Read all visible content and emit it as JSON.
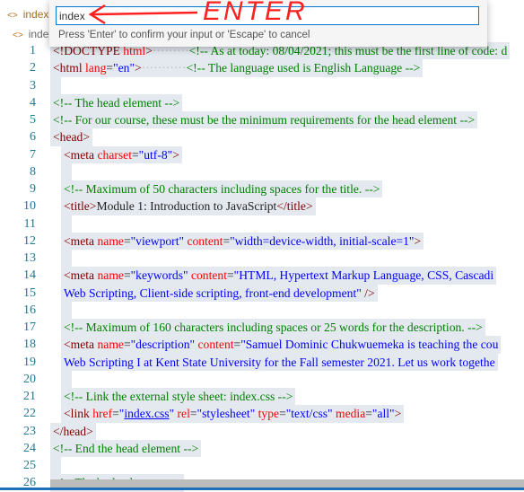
{
  "tab": {
    "label": "index.h",
    "icon": "code-file-icon"
  },
  "breadcrumb": {
    "label": "index.l",
    "icon": "code-file-icon"
  },
  "quick_input": {
    "value": "index",
    "hint": "Press 'Enter' to confirm your input or 'Escape' to cancel"
  },
  "annotation": {
    "text": "ENTER",
    "color": "#ff2020"
  },
  "colors": {
    "tag": "#800000",
    "attribute": "#ff0000",
    "value": "#0000ff",
    "comment": "#008000",
    "line_number": "#237893",
    "selection": "#e4e9f0"
  },
  "lines": [
    {
      "n": "1",
      "indent": 0,
      "t": [
        [
          "tag",
          "<!DOCTYPE "
        ],
        [
          "attr",
          "html"
        ],
        [
          "tag",
          ">"
        ],
        [
          "dots",
          "·········"
        ],
        [
          "cm",
          "<!-- As at today: 08/04/2021; this must be the first line of code: d"
        ]
      ]
    },
    {
      "n": "2",
      "indent": 0,
      "t": [
        [
          "tag",
          "<html "
        ],
        [
          "attr",
          "lang"
        ],
        [
          "pl",
          "="
        ],
        [
          "val",
          "\"en\""
        ],
        [
          "tag",
          ">"
        ],
        [
          "dots",
          "···········"
        ],
        [
          "cm",
          "<!-- The language used is English Language -->"
        ]
      ]
    },
    {
      "n": "3",
      "indent": 0,
      "t": []
    },
    {
      "n": "4",
      "indent": 0,
      "t": [
        [
          "cm",
          "<!-- The head element -->"
        ]
      ]
    },
    {
      "n": "5",
      "indent": 0,
      "t": [
        [
          "cm",
          "<!-- For our course, these must be the minimum requirements for the head element -->"
        ]
      ]
    },
    {
      "n": "6",
      "indent": 0,
      "t": [
        [
          "tag",
          "<head>"
        ]
      ]
    },
    {
      "n": "7",
      "indent": 1,
      "t": [
        [
          "tag",
          "<meta "
        ],
        [
          "attr",
          "charset"
        ],
        [
          "pl",
          "="
        ],
        [
          "val",
          "\"utf-8\""
        ],
        [
          "tag",
          ">"
        ]
      ]
    },
    {
      "n": "8",
      "indent": 1,
      "t": []
    },
    {
      "n": "9",
      "indent": 1,
      "t": [
        [
          "cm",
          "<!-- Maximum of 50 characters including spaces for the title. -->"
        ]
      ]
    },
    {
      "n": "10",
      "indent": 1,
      "t": [
        [
          "tag",
          "<title>"
        ],
        [
          "pl",
          "Module 1: Introduction to JavaScript"
        ],
        [
          "tag",
          "</title>"
        ]
      ]
    },
    {
      "n": "11",
      "indent": 1,
      "t": []
    },
    {
      "n": "12",
      "indent": 1,
      "t": [
        [
          "tag",
          "<meta "
        ],
        [
          "attr",
          "name"
        ],
        [
          "pl",
          "="
        ],
        [
          "val",
          "\"viewport\""
        ],
        [
          "pl",
          " "
        ],
        [
          "attr",
          "content"
        ],
        [
          "pl",
          "="
        ],
        [
          "val",
          "\"width=device-width, initial-scale=1\""
        ],
        [
          "tag",
          ">"
        ]
      ]
    },
    {
      "n": "13",
      "indent": 1,
      "t": []
    },
    {
      "n": "14",
      "indent": 1,
      "t": [
        [
          "tag",
          "<meta "
        ],
        [
          "attr",
          "name"
        ],
        [
          "pl",
          "="
        ],
        [
          "val",
          "\"keywords\""
        ],
        [
          "pl",
          " "
        ],
        [
          "attr",
          "content"
        ],
        [
          "pl",
          "="
        ],
        [
          "val",
          "\"HTML, Hypertext Markup Language, CSS, Cascadi"
        ]
      ]
    },
    {
      "n": "15",
      "indent": 1,
      "t": [
        [
          "val",
          "Web Scripting, Client-side scripting, front-end development\""
        ],
        [
          "tag",
          " />"
        ]
      ]
    },
    {
      "n": "16",
      "indent": 1,
      "t": []
    },
    {
      "n": "17",
      "indent": 1,
      "t": [
        [
          "cm",
          "<!-- Maximum of 160 characters including spaces or 25 words for the description. -->"
        ]
      ]
    },
    {
      "n": "18",
      "indent": 1,
      "t": [
        [
          "tag",
          "<meta "
        ],
        [
          "attr",
          "name"
        ],
        [
          "pl",
          "="
        ],
        [
          "val",
          "\"description\""
        ],
        [
          "pl",
          " "
        ],
        [
          "attr",
          "content"
        ],
        [
          "pl",
          "="
        ],
        [
          "val",
          "\"Samuel Dominic Chukwuemeka is teaching the cou"
        ]
      ]
    },
    {
      "n": "19",
      "indent": 1,
      "t": [
        [
          "val",
          "Web Scripting I at Kent State University for the Fall semester 2021. Let us work togethe"
        ]
      ]
    },
    {
      "n": "20",
      "indent": 1,
      "t": []
    },
    {
      "n": "21",
      "indent": 1,
      "t": [
        [
          "cm",
          "<!-- Link the external style sheet: index.css -->"
        ]
      ]
    },
    {
      "n": "22",
      "indent": 1,
      "t": [
        [
          "tag",
          "<link "
        ],
        [
          "attr",
          "href"
        ],
        [
          "pl",
          "="
        ],
        [
          "val",
          "\""
        ],
        [
          "val under",
          "index.css"
        ],
        [
          "val",
          "\""
        ],
        [
          "pl",
          " "
        ],
        [
          "attr",
          "rel"
        ],
        [
          "pl",
          "="
        ],
        [
          "val",
          "\"stylesheet\""
        ],
        [
          "pl",
          " "
        ],
        [
          "attr",
          "type"
        ],
        [
          "pl",
          "="
        ],
        [
          "val",
          "\"text/css\""
        ],
        [
          "pl",
          " "
        ],
        [
          "attr",
          "media"
        ],
        [
          "pl",
          "="
        ],
        [
          "val",
          "\"all\""
        ],
        [
          "tag",
          ">"
        ]
      ]
    },
    {
      "n": "23",
      "indent": 0,
      "t": [
        [
          "tag",
          "</head>"
        ]
      ]
    },
    {
      "n": "24",
      "indent": 0,
      "t": [
        [
          "cm",
          "<!-- End the head element -->"
        ]
      ]
    },
    {
      "n": "25",
      "indent": 0,
      "t": []
    },
    {
      "n": "26",
      "indent": 0,
      "t": [
        [
          "cm",
          "<!-- The body element -->"
        ]
      ]
    }
  ]
}
